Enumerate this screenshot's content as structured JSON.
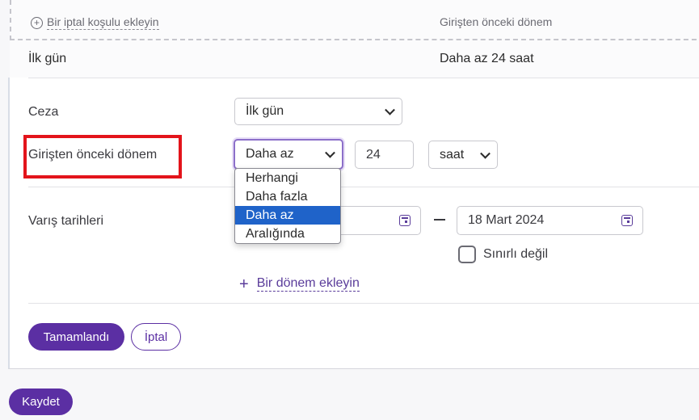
{
  "header": {
    "add_condition_label": "Bir iptal koşulu ekleyin",
    "column_before_checkin": "Girişten önceki dönem"
  },
  "summary_row": {
    "penalty": "İlk gün",
    "period": "Daha az 24 saat"
  },
  "form": {
    "penalty_label": "Ceza",
    "penalty_value": "İlk gün",
    "period_label": "Girişten önceki dönem",
    "period_operator": "Daha az",
    "period_amount": "24",
    "period_unit": "saat",
    "arrival_label": "Varış tarihleri",
    "date_end": "18 Mart 2024",
    "unlimited_label": "Sınırlı değil",
    "add_period_label": "Bir dönem ekleyin"
  },
  "dropdown": {
    "options": [
      "Herhangi",
      "Daha fazla",
      "Daha az",
      "Aralığında"
    ],
    "selected": "Daha az"
  },
  "buttons": {
    "done": "Tamamlandı",
    "cancel": "İptal",
    "save": "Kaydet"
  },
  "colors": {
    "primary": "#5b2fa3",
    "highlight": "#e3141b",
    "selection": "#1f63c9"
  }
}
